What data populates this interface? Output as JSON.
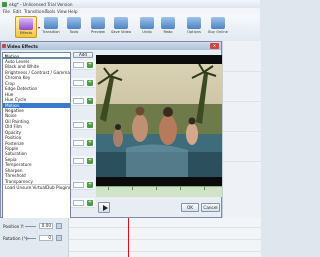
{
  "window": {
    "title": "ekg* - Unlicensed Trial Version"
  },
  "menu": [
    "File",
    "Edit",
    "Transitions",
    "Tools",
    "View",
    "Help"
  ],
  "toolbar": [
    {
      "label": "Effects",
      "icon": "effects-icon",
      "active": true
    },
    {
      "label": "Transition",
      "icon": "transition-icon"
    },
    {
      "label": "Tools",
      "icon": "tools-icon"
    },
    {
      "label": "Preview",
      "icon": "preview-icon"
    },
    {
      "label": "Save Video",
      "icon": "save-video-icon"
    },
    {
      "label": "Undo",
      "icon": "undo-icon"
    },
    {
      "label": "Redo",
      "icon": "redo-icon"
    },
    {
      "label": "Options",
      "icon": "options-icon"
    },
    {
      "label": "Buy Online",
      "icon": "cart-icon"
    }
  ],
  "dialog": {
    "title": "Video Effects",
    "selected_effect": "Motion",
    "add_label": "Add",
    "effects": [
      "Auto Levels",
      "Black and White",
      "Brightness / Contrast / Gamma",
      "Chroma Key",
      "Crop",
      "Edge Detection",
      "Hue",
      "Hue Cycle",
      "Motion",
      "Negative",
      "Noise",
      "Oil Painting",
      "Old Film",
      "Opacity",
      "Position",
      "Posterize",
      "Ripple",
      "Saturation",
      "Sepia",
      "Temperature",
      "Sharpen",
      "Threshold",
      "Transparency",
      "Load Unsure VirtualDub Plugins"
    ],
    "selected_index": 8,
    "ok_label": "OK",
    "cancel_label": "Cancel"
  },
  "lower": {
    "position_label": "Position Y:",
    "position_value": "0.00",
    "rotation_label": "Rotation (°):",
    "rotation_value": "0"
  },
  "colors": {
    "accent": "#3b79c9",
    "timeline": "#cfe3c6",
    "playhead": "#dd1111"
  }
}
